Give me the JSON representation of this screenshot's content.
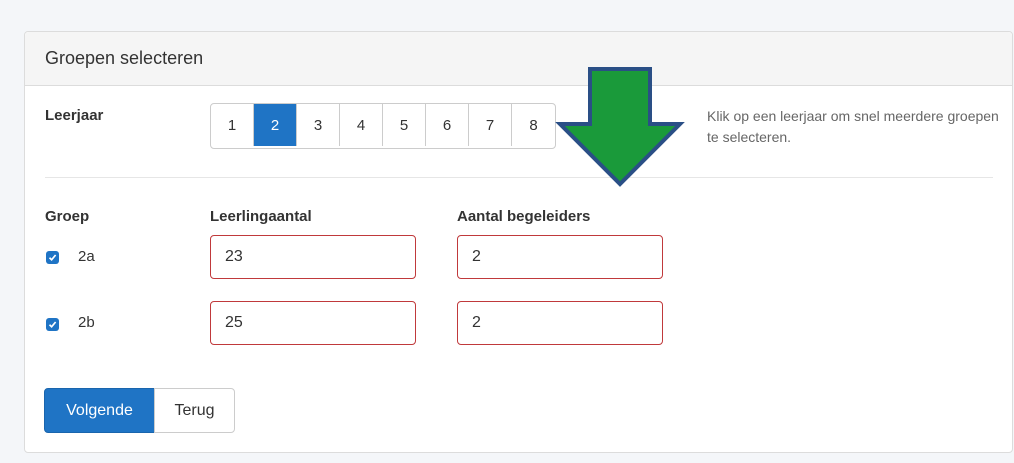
{
  "panel": {
    "title": "Groepen selecteren"
  },
  "grade": {
    "label": "Leerjaar",
    "options": [
      "1",
      "2",
      "3",
      "4",
      "5",
      "6",
      "7",
      "8"
    ],
    "selected": "2",
    "help": "Klik op een leerjaar om snel meerdere groepen te selecteren."
  },
  "table": {
    "headers": {
      "group": "Groep",
      "students": "Leerlingaantal",
      "supervisors": "Aantal begeleiders"
    },
    "rows": [
      {
        "group": "2a",
        "checked": true,
        "students": "23",
        "supervisors": "2"
      },
      {
        "group": "2b",
        "checked": true,
        "students": "25",
        "supervisors": "2"
      }
    ]
  },
  "actions": {
    "next": "Volgende",
    "back": "Terug"
  },
  "colors": {
    "primary": "#1f74c5",
    "error_border": "#c0393b",
    "arrow_fill": "#1a9a3a",
    "arrow_stroke": "#2a4f86"
  }
}
